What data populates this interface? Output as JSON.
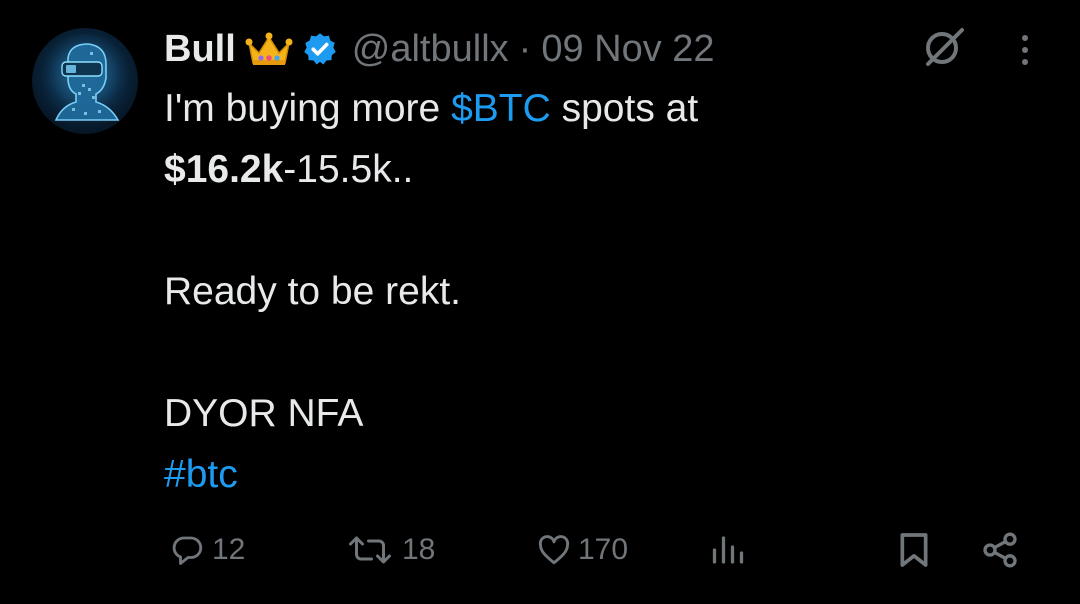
{
  "tweet": {
    "author_name": "Bull",
    "author_emoji": "crown",
    "handle": "@altbullx",
    "separator": "·",
    "date": "09 Nov 22",
    "text": {
      "l1_pre": "I'm buying more ",
      "l1_cashtag": "$BTC",
      "l1_post": " spots at",
      "l2_bold": "$16.2k",
      "l2_post": "-15.5k..",
      "l3": "Ready to be rekt.",
      "l4": "DYOR NFA",
      "hashtag": "#btc"
    }
  },
  "actions": {
    "replies": "12",
    "reposts": "18",
    "likes": "170"
  },
  "icons": {
    "grok": "grok-icon",
    "more": "more-vertical-icon",
    "reply": "reply-icon",
    "repost": "repost-icon",
    "like": "heart-icon",
    "views": "views-icon",
    "bookmark": "bookmark-icon",
    "share": "share-icon",
    "verified": "verified-badge-icon"
  },
  "colors": {
    "background": "#000000",
    "text": "#e7e9ea",
    "muted": "#71767b",
    "link": "#1d9bf0",
    "verified": "#1d9bf0"
  }
}
